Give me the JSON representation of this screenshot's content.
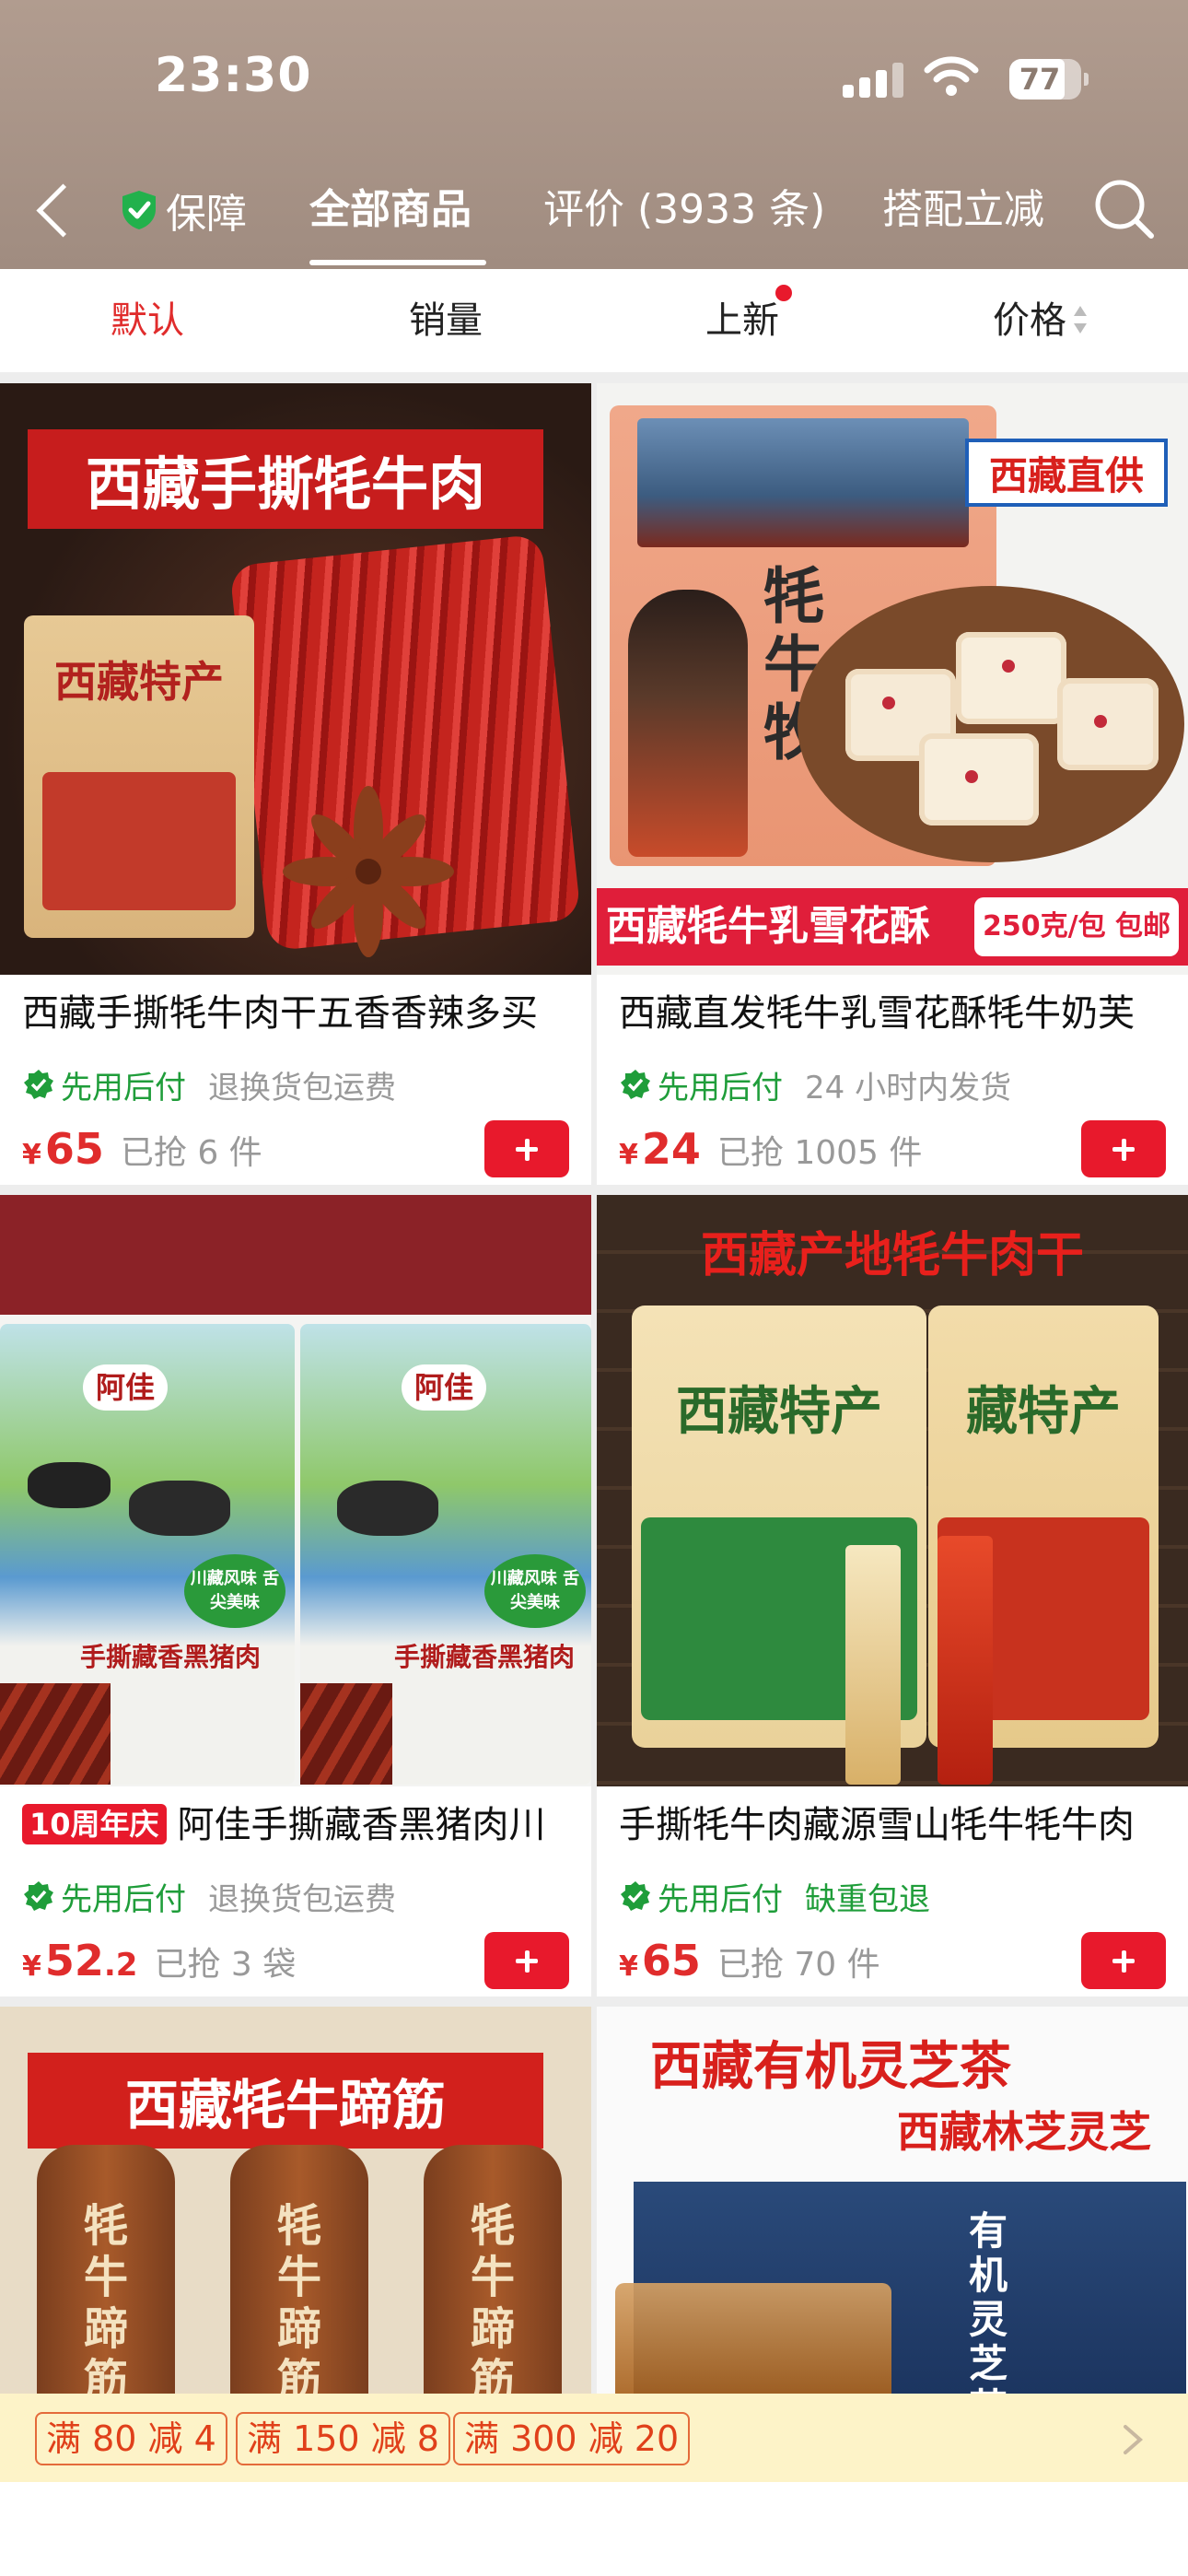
{
  "status_bar": {
    "time": "23:30",
    "battery": "77"
  },
  "nav": {
    "guarantee": "保障",
    "tabs": [
      "全部商品",
      "评价 (3933 条)",
      "搭配立减"
    ]
  },
  "sort": {
    "items": [
      "默认",
      "销量",
      "上新",
      "价格"
    ]
  },
  "products": [
    {
      "title": "西藏手撕牦牛肉干五香香辣多买",
      "pay_later": "先用后付",
      "service": "退换货包运费",
      "yen": "¥",
      "price_int": "65",
      "price_dec": "",
      "sold": "已抢 6 件",
      "image_texts": {
        "banner": "西藏手撕牦牛肉",
        "bag": "西藏特产"
      }
    },
    {
      "title": "西藏直发牦牛乳雪花酥牦牛奶芙",
      "pay_later": "先用后付",
      "service": "24 小时内发货",
      "yen": "¥",
      "price_int": "24",
      "price_dec": "",
      "sold": "已抢 1005 件",
      "image_texts": {
        "corner": "西藏直供",
        "bag": "牦牛牧",
        "banner": "西藏牦牛乳雪花酥",
        "banner_tag": "250克/包 包邮"
      }
    },
    {
      "badge": "10周年庆",
      "title": "阿佳手撕藏香黑猪肉川",
      "pay_later": "先用后付",
      "service": "退换货包运费",
      "yen": "¥",
      "price_int": "52",
      "price_dec": ".2",
      "sold": "已抢 3 袋",
      "image_texts": {
        "brand": "阿佳",
        "product": "手撕藏香黑猪肉",
        "seal": "川藏风味 舌尖美味"
      }
    },
    {
      "title": "手撕牦牛肉藏源雪山牦牛牦牛肉",
      "pay_later": "先用后付",
      "service": "缺重包退",
      "yen": "¥",
      "price_int": "65",
      "price_dec": "",
      "sold": "已抢 70 件",
      "image_texts": {
        "banner": "西藏产地牦牛肉干",
        "bag": "西藏特产",
        "bag2": "藏特产"
      }
    },
    {
      "image_texts": {
        "banner": "西藏牦牛蹄筋",
        "pack": "牦牛蹄筋"
      }
    },
    {
      "image_texts": {
        "title": "西藏有机灵芝茶",
        "subtitle": "西藏林芝灵芝",
        "box": "有机灵芝茶"
      }
    }
  ],
  "promo": {
    "coupons": [
      "满 80 减 4",
      "满 150 减 8",
      "满 300 减 20"
    ]
  },
  "colors": {
    "accent_red": "#e8192c",
    "green": "#1f9d3a",
    "header_bg": "#a99589"
  }
}
